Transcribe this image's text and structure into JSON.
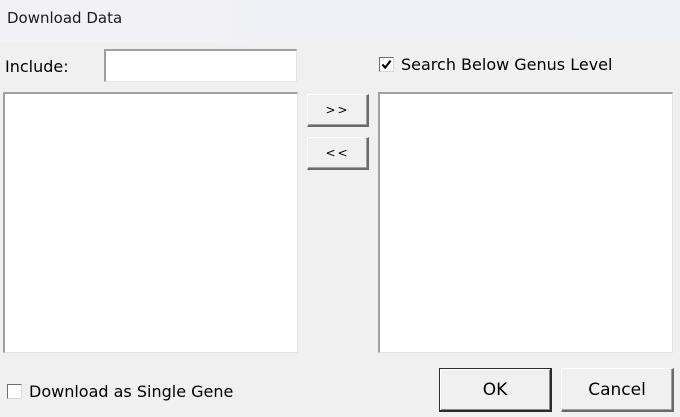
{
  "window": {
    "title": "Download Data"
  },
  "include": {
    "label": "Include:",
    "value": "",
    "placeholder": ""
  },
  "options": {
    "search_below_genus": {
      "label": "Search Below Genus Level",
      "checked": true
    },
    "download_single_gene": {
      "label": "Download as Single Gene",
      "checked": false
    }
  },
  "transfer": {
    "add_label": ">>",
    "remove_label": "<<"
  },
  "lists": {
    "available": [],
    "selected": []
  },
  "buttons": {
    "ok_label": "OK",
    "cancel_label": "Cancel"
  },
  "icons": {
    "checkmark": "checkmark-icon"
  }
}
